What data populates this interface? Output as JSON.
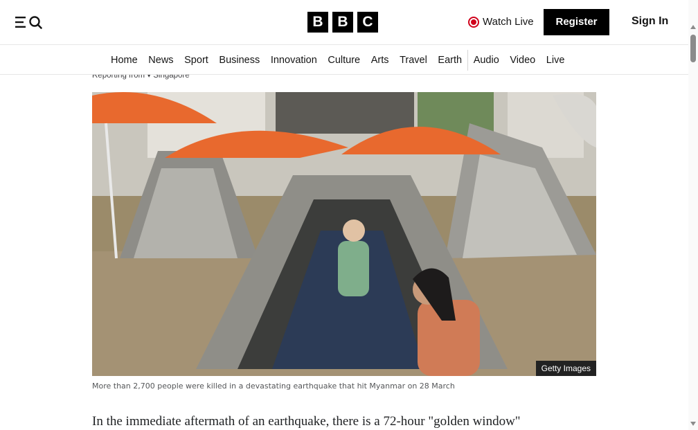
{
  "header": {
    "logo_letters": [
      "B",
      "B",
      "C"
    ],
    "watch_live_label": "Watch Live",
    "register_label": "Register",
    "sign_in_label": "Sign In",
    "menu_icon": "menu-icon",
    "search_icon": "search-icon",
    "live_icon": "live-dot-icon"
  },
  "nav": {
    "items": [
      "Home",
      "News",
      "Sport",
      "Business",
      "Innovation",
      "Culture",
      "Arts",
      "Travel",
      "Earth",
      "Audio",
      "Video",
      "Live"
    ]
  },
  "article": {
    "reporting": "Reporting from ▾ Singapore",
    "image_credit": "Getty Images",
    "caption": "More than 2,700 people were killed in a devastating earthquake that hit Myanmar on 28 March",
    "paragraph": "In the immediate aftermath of an earthquake, there is a 72-hour \"golden window\""
  },
  "colors": {
    "live_red": "#d0021b",
    "brand_black": "#000000"
  }
}
